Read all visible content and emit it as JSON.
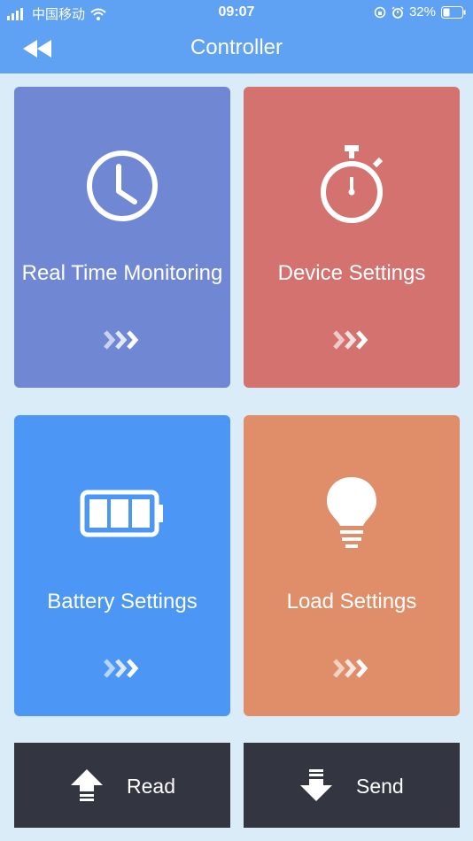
{
  "status": {
    "carrier": "中国移动",
    "time": "09:07",
    "battery": "32%"
  },
  "header": {
    "title": "Controller"
  },
  "tiles": [
    {
      "label": "Real Time Monitoring",
      "color": "#7087d4"
    },
    {
      "label": "Device Settings",
      "color": "#d47270"
    },
    {
      "label": "Battery Settings",
      "color": "#4c97f5"
    },
    {
      "label": "Load Settings",
      "color": "#e08e69"
    }
  ],
  "actions": {
    "read": "Read",
    "send": "Send"
  },
  "colors": {
    "header": "#5fa1f3",
    "background": "#d9ecf8",
    "action_bar": "#333540"
  },
  "icons": [
    "signal-icon",
    "wifi-icon",
    "back-icon",
    "clock-icon",
    "stopwatch-icon",
    "battery-icon",
    "bulb-icon",
    "upload-arrow-icon",
    "download-arrow-icon"
  ]
}
